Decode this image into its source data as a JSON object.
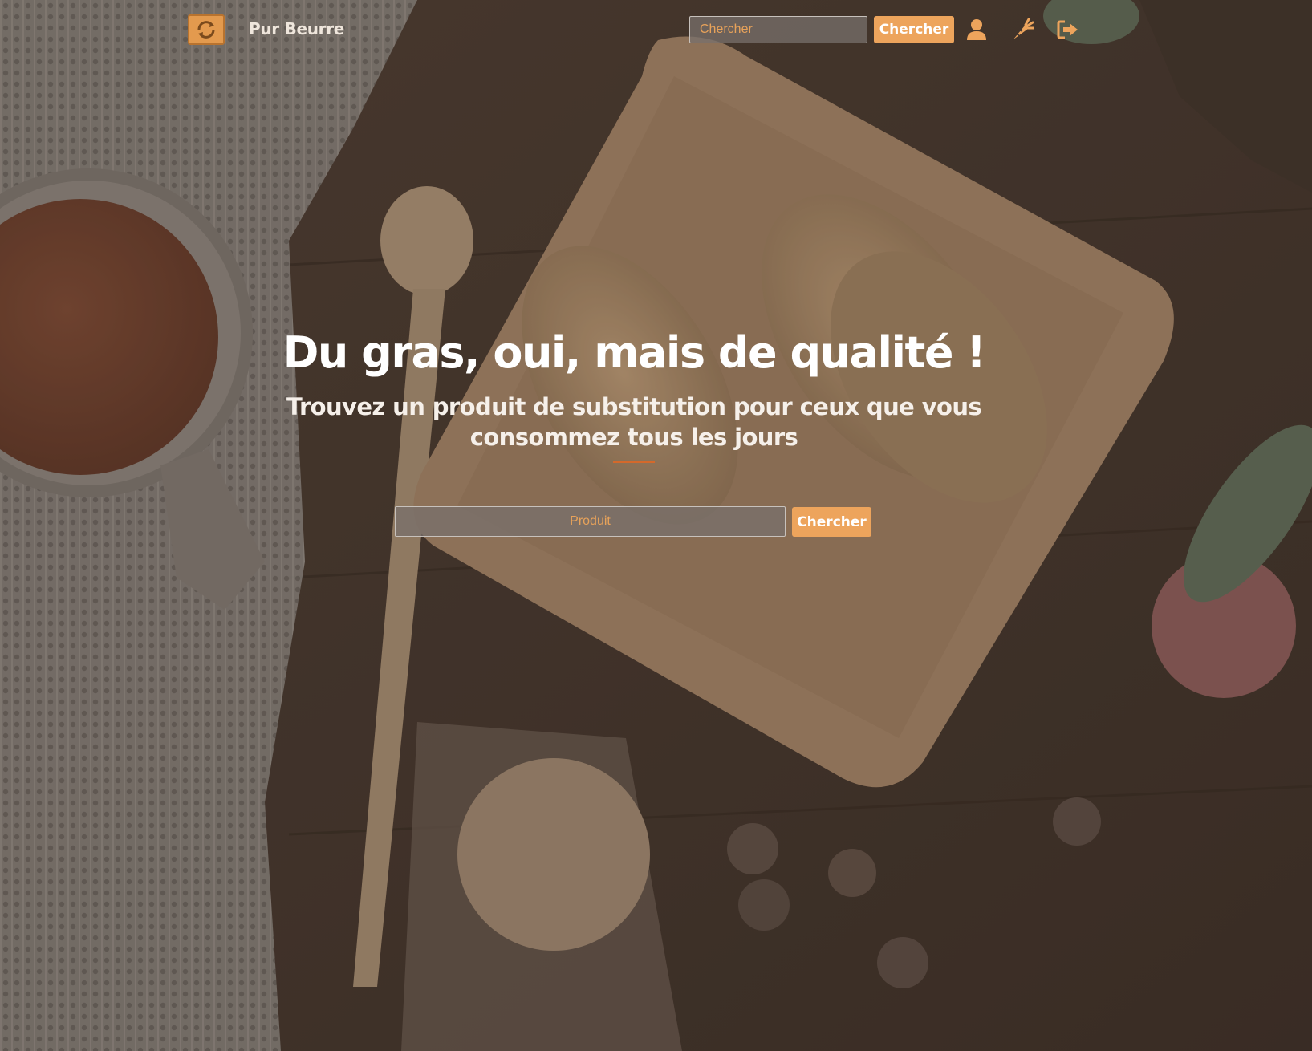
{
  "brand": {
    "name": "Pur Beurre",
    "logo_icon": "refresh-icon"
  },
  "nav": {
    "search_placeholder": "Chercher",
    "search_button": "Chercher",
    "icons": [
      "user-icon",
      "carrot-icon",
      "sign-out-icon"
    ]
  },
  "hero": {
    "title": "Du gras, oui, mais de qualité !",
    "subtitle": "Trouvez un produit de substitution pour ceux que vous consommez tous les jours",
    "search_placeholder": "Produit",
    "search_button": "Chercher"
  },
  "colors": {
    "accent": "#eda45c",
    "divider": "#d4692b",
    "text": "#ffffff"
  }
}
